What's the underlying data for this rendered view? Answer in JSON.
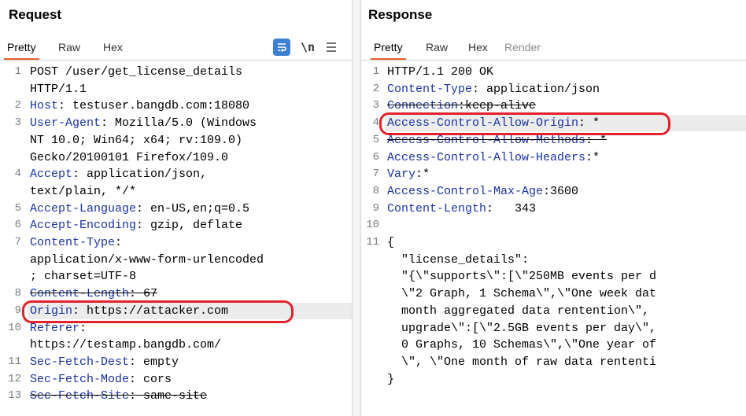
{
  "request": {
    "title": "Request",
    "tabs": [
      "Pretty",
      "Raw",
      "Hex"
    ],
    "tools": [
      "wrap-lines-icon",
      "newline-icon",
      "menu-icon"
    ],
    "newline_glyph": "\\n",
    "lines": [
      {
        "n": "1",
        "name": "",
        "value": "POST /user/get_license_details"
      },
      {
        "n": "",
        "name": "",
        "value": "HTTP/1.1"
      },
      {
        "n": "2",
        "name": "Host",
        "value": ": testuser.bangdb.com:18080"
      },
      {
        "n": "3",
        "name": "User-Agent",
        "value": ": Mozilla/5.0 (Windows"
      },
      {
        "n": "",
        "name": "",
        "value": "NT 10.0; Win64; x64; rv:109.0)"
      },
      {
        "n": "",
        "name": "",
        "value": "Gecko/20100101 Firefox/109.0"
      },
      {
        "n": "4",
        "name": "Accept",
        "value": ": application/json,"
      },
      {
        "n": "",
        "name": "",
        "value": "text/plain, */*"
      },
      {
        "n": "5",
        "name": "Accept-Language",
        "value": ": en-US,en;q=0.5"
      },
      {
        "n": "6",
        "name": "Accept-Encoding",
        "value": ": gzip, deflate"
      },
      {
        "n": "7",
        "name": "Content-Type",
        "value": ":"
      },
      {
        "n": "",
        "name": "",
        "value": "application/x-www-form-urlencoded"
      },
      {
        "n": "",
        "name": "",
        "value": "; charset=UTF-8"
      },
      {
        "n": "8",
        "name": "Content-Length",
        "value": ": 67"
      },
      {
        "n": "9",
        "name": "Origin",
        "value": ": https://attacker.com"
      },
      {
        "n": "10",
        "name": "Referer",
        "value": ":"
      },
      {
        "n": "",
        "name": "",
        "value": "https://testamp.bangdb.com/"
      },
      {
        "n": "11",
        "name": "Sec-Fetch-Dest",
        "value": ": empty"
      },
      {
        "n": "12",
        "name": "Sec-Fetch-Mode",
        "value": ": cors"
      },
      {
        "n": "13",
        "name": "Sec-Fetch-Site",
        "value": ": same-site"
      }
    ]
  },
  "response": {
    "title": "Response",
    "tabs": [
      "Pretty",
      "Raw",
      "Hex",
      "Render"
    ],
    "lines": [
      {
        "n": "1",
        "name": "",
        "value": "HTTP/1.1 200 OK"
      },
      {
        "n": "2",
        "name": "Content-Type",
        "value": ": application/json"
      },
      {
        "n": "3",
        "name": "Connection",
        "value": ":keep-alive"
      },
      {
        "n": "4",
        "name": "Access-Control-Allow-Origin",
        "value": ": *"
      },
      {
        "n": "5",
        "name": "Access-Control-Allow-Methods",
        "value": ": *"
      },
      {
        "n": "6",
        "name": "Access-Control-Allow-Headers",
        "value": ":*"
      },
      {
        "n": "7",
        "name": "Vary",
        "value": ":*"
      },
      {
        "n": "8",
        "name": "Access-Control-Max-Age",
        "value": ":3600"
      },
      {
        "n": "9",
        "name": "Content-Length",
        "value": ":   343"
      },
      {
        "n": "10",
        "name": "",
        "value": ""
      },
      {
        "n": "11",
        "name": "",
        "value": "{"
      },
      {
        "n": "",
        "name": "",
        "value": "  \"license_details\":"
      },
      {
        "n": "",
        "name": "",
        "value": "  \"{\\\"supports\\\":[\\\"250MB events per d"
      },
      {
        "n": "",
        "name": "",
        "value": "  \\\"2 Graph, 1 Schema\\\",\\\"One week dat"
      },
      {
        "n": "",
        "name": "",
        "value": "  month aggregated data rentention\\\","
      },
      {
        "n": "",
        "name": "",
        "value": "  upgrade\\\":[\\\"2.5GB events per day\\\","
      },
      {
        "n": "",
        "name": "",
        "value": "  0 Graphs, 10 Schemas\\\",\\\"One year of"
      },
      {
        "n": "",
        "name": "",
        "value": "  \\\", \\\"One month of raw data rententi"
      },
      {
        "n": "",
        "name": "",
        "value": "}"
      }
    ]
  },
  "colors": {
    "accent": "#e8632b",
    "header_name": "#1a33a6",
    "annotation": "#e2222c",
    "wrap_button": "#3f7fd1"
  }
}
